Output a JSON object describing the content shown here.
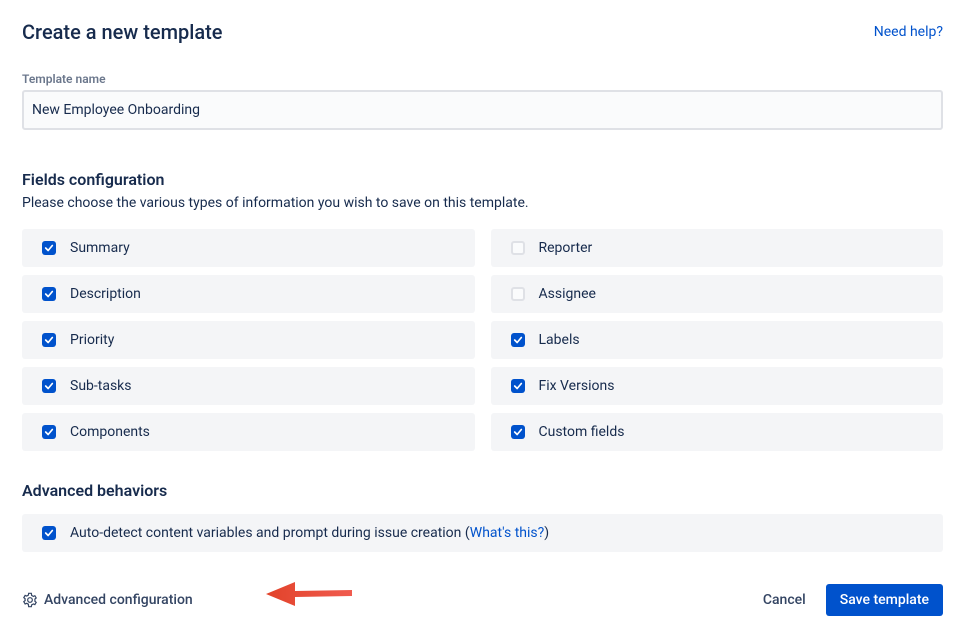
{
  "header": {
    "title": "Create a new template",
    "help_link": "Need help?"
  },
  "template_name": {
    "label": "Template name",
    "value": "New Employee Onboarding"
  },
  "fields_config": {
    "title": "Fields configuration",
    "description": "Please choose the various types of information you wish to save on this template.",
    "left": [
      {
        "label": "Summary",
        "checked": true
      },
      {
        "label": "Description",
        "checked": true
      },
      {
        "label": "Priority",
        "checked": true
      },
      {
        "label": "Sub-tasks",
        "checked": true
      },
      {
        "label": "Components",
        "checked": true
      }
    ],
    "right": [
      {
        "label": "Reporter",
        "checked": false
      },
      {
        "label": "Assignee",
        "checked": false
      },
      {
        "label": "Labels",
        "checked": true
      },
      {
        "label": "Fix Versions",
        "checked": true
      },
      {
        "label": "Custom fields",
        "checked": true
      }
    ]
  },
  "behaviors": {
    "title": "Advanced behaviors",
    "auto_detect": {
      "checked": true,
      "text_before": "Auto-detect content variables and prompt during issue creation (",
      "link": "What's this?",
      "text_after": ")"
    }
  },
  "footer": {
    "advanced_config": "Advanced configuration",
    "cancel": "Cancel",
    "save": "Save template"
  }
}
